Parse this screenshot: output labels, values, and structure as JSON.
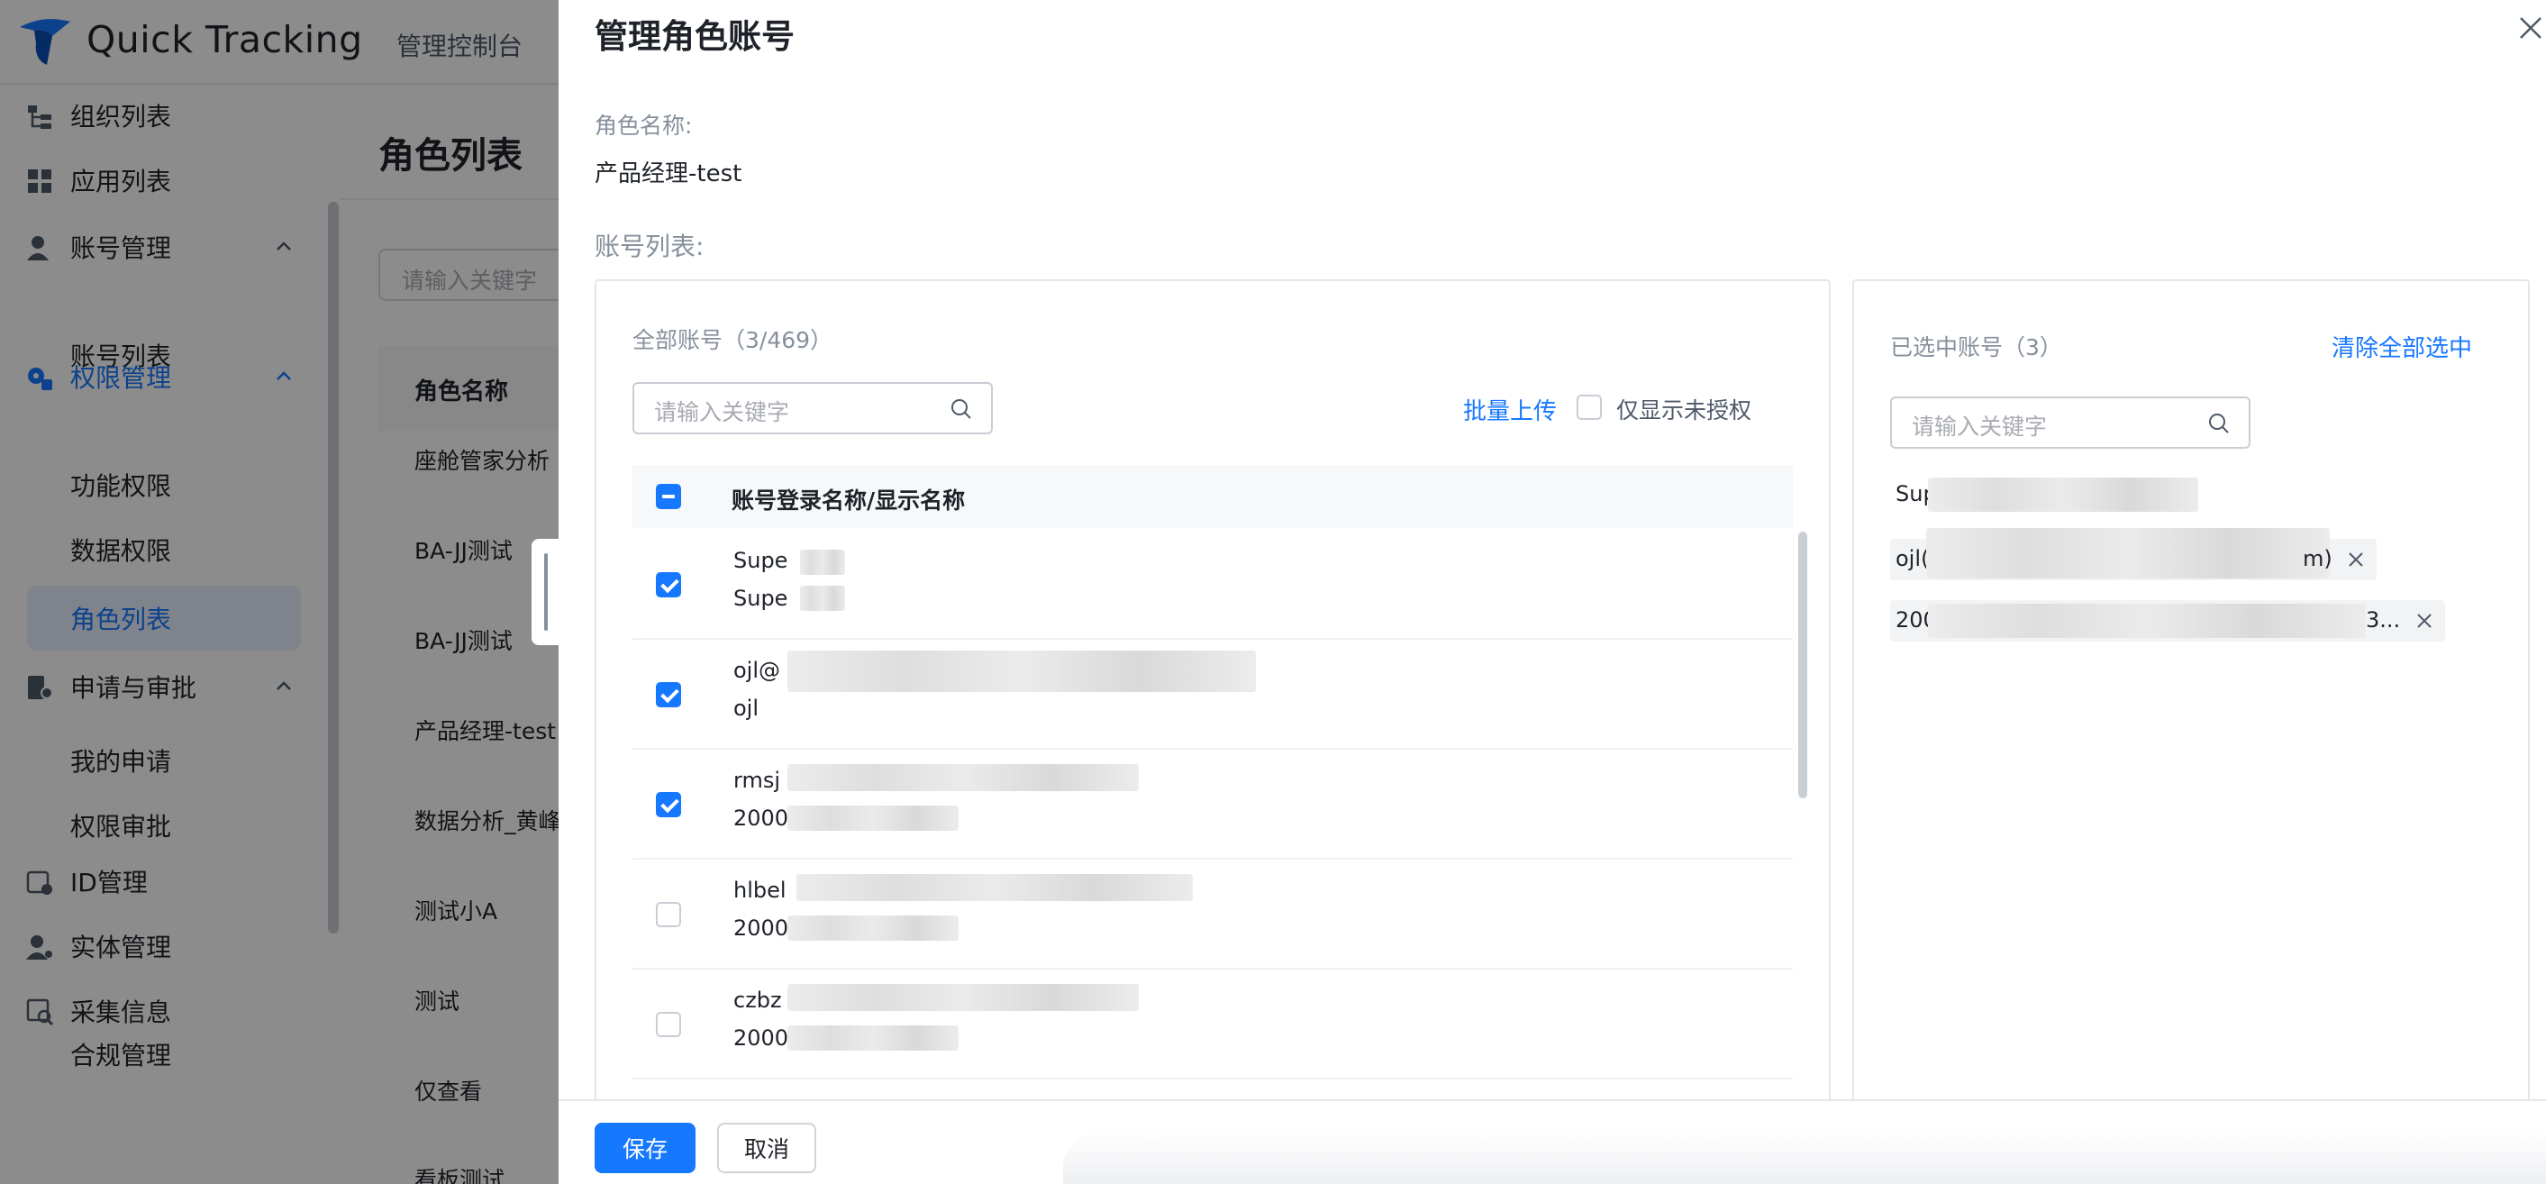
{
  "app": {
    "name": "Quick Tracking",
    "top_menu": "管理控制台"
  },
  "sidebar": {
    "items": [
      {
        "label": "组织列表",
        "icon": "org-tree-icon"
      },
      {
        "label": "应用列表",
        "icon": "app-grid-icon"
      },
      {
        "label": "账号管理",
        "icon": "user-icon",
        "expanded": true
      },
      {
        "label": "账号列表",
        "sub": true
      },
      {
        "label": "权限管理",
        "icon": "permission-icon",
        "expanded": true,
        "active": true
      },
      {
        "label": "功能权限",
        "sub": true
      },
      {
        "label": "数据权限",
        "sub": true
      },
      {
        "label": "角色列表",
        "sub": true,
        "selected": true
      },
      {
        "label": "申请与审批",
        "icon": "approval-icon",
        "expanded": true
      },
      {
        "label": "我的申请",
        "sub": true
      },
      {
        "label": "权限审批",
        "sub": true
      },
      {
        "label": "ID管理",
        "icon": "id-icon"
      },
      {
        "label": "实体管理",
        "icon": "entity-icon"
      },
      {
        "label": "采集信息",
        "icon": "collect-icon"
      },
      {
        "label": "合规管理",
        "icon": "compliance-icon"
      }
    ]
  },
  "page": {
    "title": "角色列表",
    "search_placeholder": "请输入关键字",
    "table_header": "角色名称",
    "roles": [
      "座舱管家分析",
      "BA-JJ测试",
      "BA-JJ测试",
      "产品经理-test",
      "数据分析_黄峰",
      "测试小A",
      "测试",
      "仅查看",
      "看板测试"
    ]
  },
  "drawer": {
    "title": "管理角色账号",
    "role_name_label": "角色名称:",
    "role_name_value": "产品经理-test",
    "account_list_label": "账号列表:",
    "all_accounts": {
      "title": "全部账号（3/469）",
      "search_placeholder": "请输入关键字",
      "batch_upload": "批量上传",
      "only_unauthorized": "仅显示未授权",
      "only_unauthorized_checked": false,
      "column_header": "账号登录名称/显示名称",
      "header_checkbox_state": "indeterminate",
      "rows": [
        {
          "line1": "Supe",
          "line2": "Supe",
          "checked": true
        },
        {
          "line1": "ojl@",
          "line2": "ojl",
          "checked": true
        },
        {
          "line1": "rmsj",
          "line2": "2000",
          "checked": true
        },
        {
          "line1": "hlbel",
          "line2": "2000",
          "checked": false
        },
        {
          "line1": "czbz",
          "line2": "2000",
          "checked": false
        }
      ]
    },
    "selected_accounts": {
      "title": "已选中账号（3）",
      "clear_all": "清除全部选中",
      "search_placeholder": "请输入关键字",
      "chips": [
        {
          "head": "Sup",
          "tail": ""
        },
        {
          "head": "ojl(",
          "tail": "m)"
        },
        {
          "head": "200",
          "tail": "3..."
        }
      ]
    },
    "footer": {
      "save": "保存",
      "cancel": "取消"
    }
  },
  "colors": {
    "accent": "#1677ff",
    "overlay": "rgba(0,0,0,0.45)",
    "muted_text": "#86909c"
  }
}
